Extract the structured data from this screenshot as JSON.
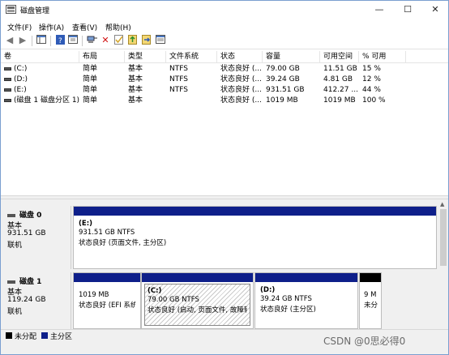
{
  "window": {
    "title": "磁盘管理",
    "min": "—",
    "max": "☐",
    "close": "✕"
  },
  "menu": [
    "文件(F)",
    "操作(A)",
    "查看(V)",
    "帮助(H)"
  ],
  "toolbar": [
    "arrow-left-icon",
    "arrow-right-icon",
    "console-view-icon",
    "help-icon",
    "properties-icon",
    "connect-icon",
    "delete-icon",
    "check-icon",
    "import-icon",
    "export-icon",
    "list-view-icon"
  ],
  "columns": [
    "卷",
    "布局",
    "类型",
    "文件系统",
    "状态",
    "容量",
    "可用空间",
    "% 可用"
  ],
  "volumes": [
    [
      "(C:)",
      "简单",
      "基本",
      "NTFS",
      "状态良好 (...",
      "79.00 GB",
      "11.51 GB",
      "15 %"
    ],
    [
      "(D:)",
      "简单",
      "基本",
      "NTFS",
      "状态良好 (...",
      "39.24 GB",
      "4.81 GB",
      "12 %"
    ],
    [
      "(E:)",
      "简单",
      "基本",
      "NTFS",
      "状态良好 (...",
      "931.51 GB",
      "412.27 ...",
      "44 %"
    ],
    [
      "(磁盘 1 磁盘分区 1)",
      "简单",
      "基本",
      "",
      "状态良好 (...",
      "1019 MB",
      "1019 MB",
      "100 %"
    ]
  ],
  "disks": [
    {
      "name": "磁盘 0",
      "type": "基本",
      "size": "931.51 GB",
      "status": "联机",
      "partitions": [
        {
          "letter": "(E:)",
          "fs": "931.51 GB NTFS",
          "status": "状态良好 (页面文件, 主分区)"
        }
      ]
    },
    {
      "name": "磁盘 1",
      "type": "基本",
      "size": "119.24 GB",
      "status": "联机",
      "partitions": [
        {
          "size": "1019 MB",
          "status": "状态良好 (EFI 系统"
        },
        {
          "letter": "(C:)",
          "fs": "79.00 GB NTFS",
          "status": "状态良好 (启动, 页面文件, 故障转"
        },
        {
          "letter": "(D:)",
          "fs": "39.24 GB NTFS",
          "status": "状态良好 (主分区)"
        },
        {
          "size": "9 M",
          "status": "未分"
        }
      ]
    }
  ],
  "legend": {
    "unallocated": "未分配",
    "primary": "主分区"
  },
  "colors": {
    "primary": "#0e1f8a",
    "unallocated": "#000000"
  },
  "watermark": "CSDN @0思必得0"
}
